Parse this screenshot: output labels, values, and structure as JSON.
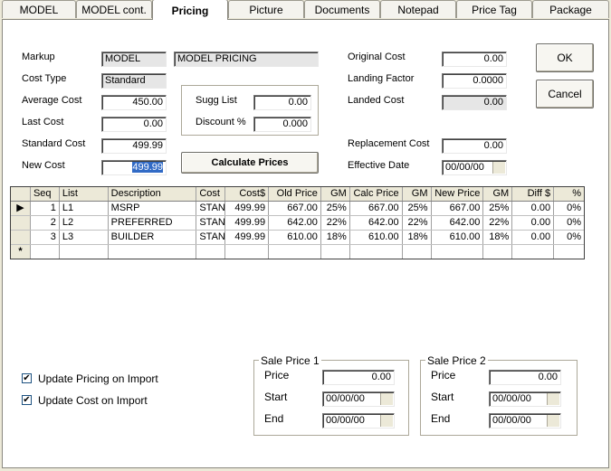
{
  "tabs": [
    {
      "label": "MODEL"
    },
    {
      "label": "MODEL cont."
    },
    {
      "label": "Pricing"
    },
    {
      "label": "Picture"
    },
    {
      "label": "Documents"
    },
    {
      "label": "Notepad"
    },
    {
      "label": "Price Tag"
    },
    {
      "label": "Package"
    }
  ],
  "left": {
    "markup_label": "Markup",
    "markup_code": "MODEL",
    "markup_name": "MODEL PRICING",
    "cost_type_label": "Cost Type",
    "cost_type_value": "Standard",
    "average_cost_label": "Average Cost",
    "average_cost_value": "450.00",
    "last_cost_label": "Last Cost",
    "last_cost_value": "0.00",
    "standard_cost_label": "Standard Cost",
    "standard_cost_value": "499.99",
    "new_cost_label": "New Cost",
    "new_cost_value": "499.99"
  },
  "sugg": {
    "sugg_list_label": "Sugg List",
    "sugg_list_value": "0.00",
    "discount_label": "Discount %",
    "discount_value": "0.000"
  },
  "calculate_label": "Calculate Prices",
  "right": {
    "original_cost_label": "Original Cost",
    "original_cost_value": "0.00",
    "landing_factor_label": "Landing Factor",
    "landing_factor_value": "0.0000",
    "landed_cost_label": "Landed Cost",
    "landed_cost_value": "0.00",
    "replacement_cost_label": "Replacement Cost",
    "replacement_cost_value": "0.00",
    "effective_date_label": "Effective Date",
    "effective_date_value": "00/00/00"
  },
  "buttons": {
    "ok": "OK",
    "cancel": "Cancel"
  },
  "grid": {
    "headers": [
      "Seq",
      "List",
      "Description",
      "Cost",
      "Cost$",
      "Old Price",
      "GM",
      "Calc Price",
      "GM",
      "New Price",
      "GM",
      "Diff $",
      "%"
    ],
    "rows": [
      [
        "1",
        "L1",
        "MSRP",
        "STAN",
        "499.99",
        "667.00",
        "25%",
        "667.00",
        "25%",
        "667.00",
        "25%",
        "0.00",
        "0%"
      ],
      [
        "2",
        "L2",
        "PREFERRED",
        "STAN",
        "499.99",
        "642.00",
        "22%",
        "642.00",
        "22%",
        "642.00",
        "22%",
        "0.00",
        "0%"
      ],
      [
        "3",
        "L3",
        "BUILDER",
        "STAN",
        "499.99",
        "610.00",
        "18%",
        "610.00",
        "18%",
        "610.00",
        "18%",
        "0.00",
        "0%"
      ]
    ],
    "new_row_marker": "*"
  },
  "checkboxes": {
    "update_pricing": "Update Pricing on Import",
    "update_cost": "Update Cost on Import"
  },
  "sale1": {
    "title": "Sale Price 1",
    "price_label": "Price",
    "price_value": "0.00",
    "start_label": "Start",
    "start_value": "00/00/00",
    "end_label": "End",
    "end_value": "00/00/00"
  },
  "sale2": {
    "title": "Sale Price 2",
    "price_label": "Price",
    "price_value": "0.00",
    "start_label": "Start",
    "start_value": "00/00/00",
    "end_label": "End",
    "end_value": "00/00/00"
  }
}
